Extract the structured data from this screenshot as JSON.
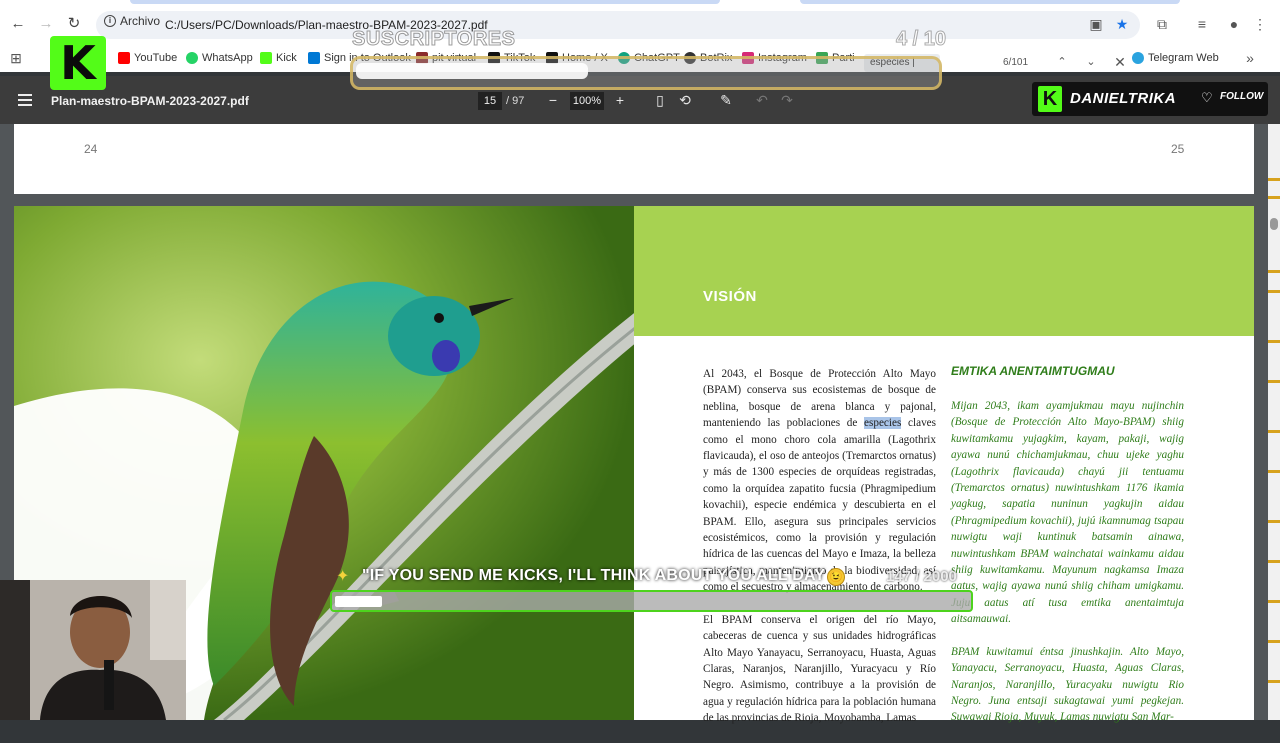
{
  "browser": {
    "site_info_label": "Archivo",
    "url": "C:/Users/PC/Downloads/Plan-maestro-BPAM-2023-2027.pdf",
    "bookmarks": [
      {
        "label": "YouTube",
        "color": "#ff0000"
      },
      {
        "label": "WhatsApp",
        "color": "#25d366"
      },
      {
        "label": "Kick",
        "color": "#53fc18"
      },
      {
        "label": "Sign in to Outlook",
        "color": "#0078d4"
      },
      {
        "label": "pit virtual",
        "color": "#8a2b2b"
      },
      {
        "label": "TikTok",
        "color": "#111111"
      },
      {
        "label": "Home / X",
        "color": "#111111"
      },
      {
        "label": "ChatGPT",
        "color": "#10a37f"
      },
      {
        "label": "BotRix",
        "color": "#333333"
      },
      {
        "label": "Instagram",
        "color": "#d62976"
      },
      {
        "label": "Parti",
        "color": "#3aa655"
      },
      {
        "label": "Telegram Web",
        "color": "#2aa3df"
      }
    ]
  },
  "find": {
    "query": "especies |",
    "count": "6/101"
  },
  "pdf": {
    "title": "Plan-maestro-BPAM-2023-2027.pdf",
    "page_current": "15",
    "page_total": "/ 97",
    "zoom": "100%",
    "prev_page_left_number": "24",
    "prev_page_right_number": "25",
    "vision_title": "VISIÓN",
    "emtika_title": "EMTIKA ANENTAIMTUGMAU",
    "es_para1_before": "Al 2043, el Bosque de Protección Alto Mayo (BPAM) conserva sus ecosistemas de bosque de neblina, bosque de arena blanca y pajonal, manteniendo las poblaciones de ",
    "es_para1_highlight": "especies",
    "es_para1_after": " claves como el mono choro cola amarilla (Lagothrix flavicauda), el oso de anteojos (Tremarctos ornatus) y más de 1300 especies de orquídeas registradas, como la orquídea zapatito fucsia (Phragmipedium kovachii), especie endémica y descubierta en el BPAM. Ello, asegura sus principales servicios ecosistémicos, como la provisión y regulación hídrica de las cuencas del Mayo e Imaza, la belleza paisajística, mantenimiento de la biodiversidad, así como el secuestro y almacenamiento de carbono.",
    "es_para2": "El BPAM conserva el origen del río Mayo, cabeceras de cuenca y sus unidades hidrográficas Alto Mayo Yanayacu, Serranoyacu, Huasta, Aguas Claras, Naranjos, Naranjillo, Yuracyacu y Río Negro. Asimismo, contribuye a la provisión de agua y regulación hídrica para la población humana de las provincias de Rioja, Moyobamba, Lamas",
    "aw_para1": "Mijan 2043, ikam ayamjukmau mayu nujinchin (Bosque de Protección Alto Mayo-BPAM) shiig kuwitamkamu yujagkim, kayam, pakaji, wajig ayawa nunú chichamjukmau, chuu ujeke yaghu (Lagothrix flavicauda) chayú jii tentuamu (Tremarctos ornatus) nuwintushkam 1176 ikamia yagkug, sapatia nuninun yagkujin aidau (Phragmipedium kovachii), jujú ikamnumag tsapau nuwigtu waji kuntinuk batsamin ainawa, nuwintushkam BPAM wainchatai wainkamu aidau shiig kuwitamkamu. Mayunum nagkamsa Imaza aatus, wajig ayawa nunú shiig chiham umigkamu. Juju aatus atí tusa emtika anentaimtuja aitsamauwai.",
    "aw_para2": "BPAM kuwitamui éntsa jinushkajin. Alto Mayo, Yanayacu, Serranoyacu, Huasta, Aguas Claras, Naranjos, Naranjillo, Yuracyaku nuwigtu Rio Negro. Juna entsaji sukagtawai yumi pegkejan. Suwawai Rioja, Muyuk, Lamas nuwigtu San Mar-"
  },
  "overlay": {
    "subs_label": "SUSCRIPTORES",
    "subs_count": "4 / 10",
    "subs_progress": 0.4,
    "channel_name": "DANIELTRIKA",
    "follow_label": "FOLLOW",
    "kick_goal_text": "\"IF YOU SEND ME KICKS, I'LL THINK ABOUT YOU ALL DAY",
    "kick_goal_count": "147 / 2000",
    "kick_goal_progress": 0.0735
  },
  "colors": {
    "kick_green": "#53fc18",
    "vision_green": "#a7d251",
    "text_green": "#2f7d1a",
    "highlight_blue": "#a9c4e8"
  }
}
